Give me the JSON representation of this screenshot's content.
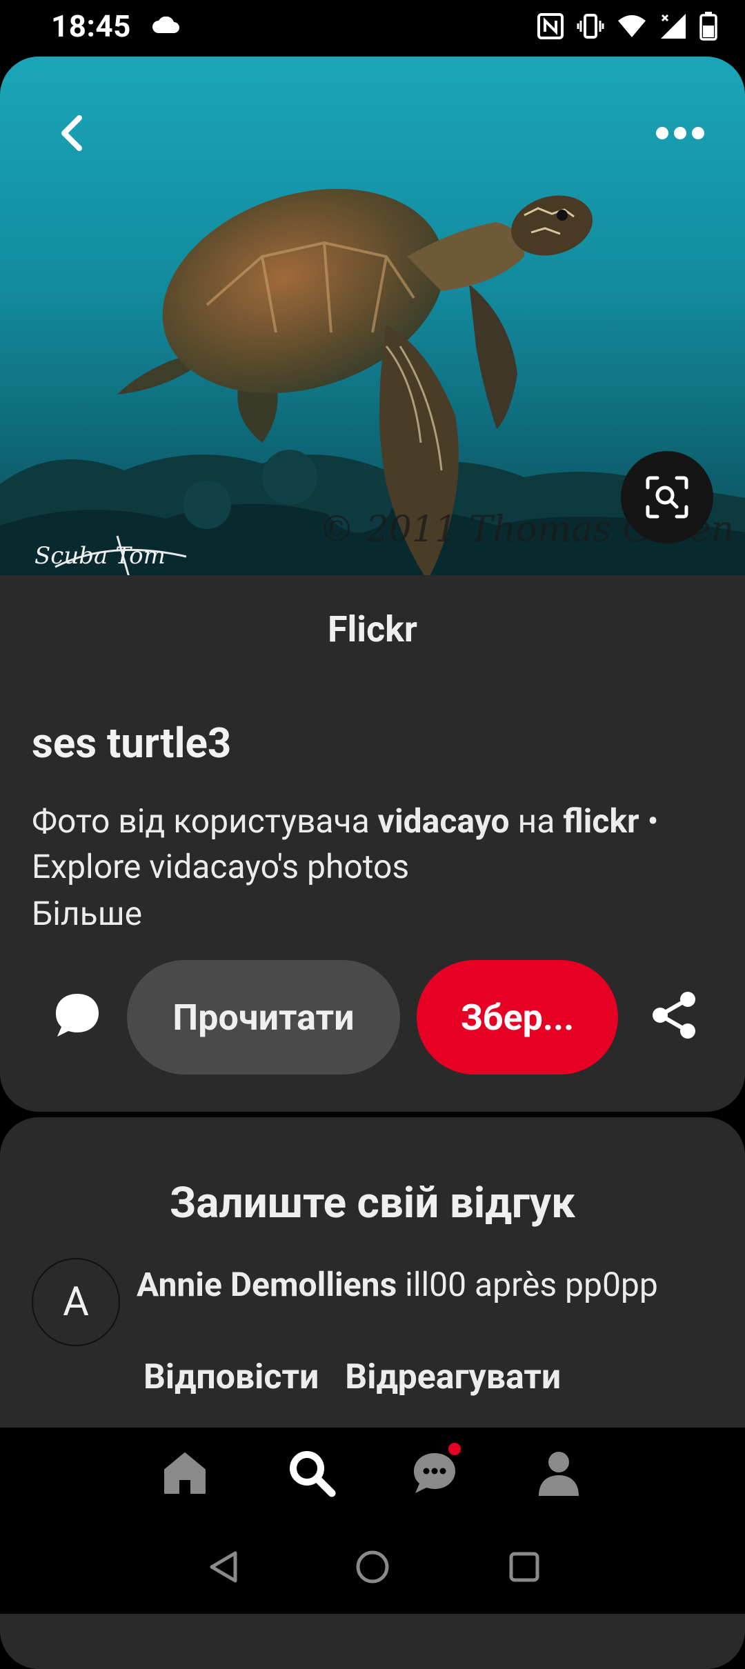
{
  "status_bar": {
    "time": "18:45",
    "icons": [
      "cloud-icon",
      "nfc-icon",
      "vibrate-icon",
      "wifi-icon",
      "signal-icon",
      "battery-icon"
    ]
  },
  "pin": {
    "image_subject": "sea turtle swimming over coral reef",
    "watermark_right": "© 2011 Thomas Green",
    "watermark_left": "Scuba Tom",
    "source": "Flickr",
    "title": "ses turtle3",
    "description": {
      "prefix": "Фото від користувача ",
      "user": "vidacayo",
      "middle": " на ",
      "site": "flickr",
      "suffix": " • Explore vidacayo's photos"
    },
    "more_link": "Більше",
    "read_button": "Прочитати",
    "save_button": "Збер...",
    "icons": {
      "back": "back-arrow-icon",
      "more": "more-options-icon",
      "lens": "visual-search-icon",
      "comment": "comment-icon",
      "share": "share-icon"
    }
  },
  "feedback": {
    "heading": "Залиште свій відгук",
    "comment": {
      "avatar_letter": "A",
      "author": "Annie Demolliens",
      "text": " ill00 après pp0pp",
      "reply": "Відповісти",
      "react": "Відреагувати"
    }
  },
  "bottom_nav": {
    "items": [
      "home-icon",
      "search-icon",
      "messages-icon",
      "profile-icon"
    ],
    "active": "search-icon",
    "notification_dot_color": "#e60023"
  },
  "colors": {
    "accent": "#e60023",
    "card_bg": "#2a2a2a",
    "secondary_button": "#4a4a4a"
  }
}
